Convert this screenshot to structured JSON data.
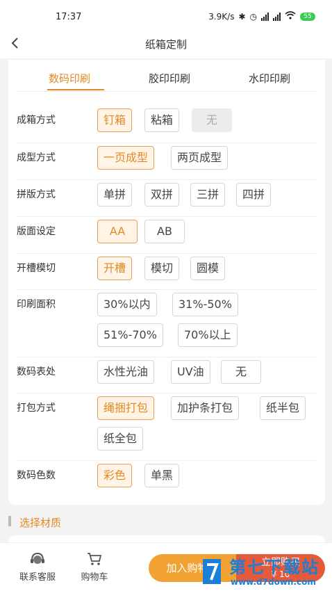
{
  "status_bar": {
    "time": "17:37",
    "net_speed": "3.9K/s",
    "battery": "55",
    "icons": [
      "bluetooth-icon",
      "alarm-icon",
      "hd-signal-icon",
      "hd-signal-icon",
      "wifi-icon",
      "battery-icon"
    ]
  },
  "nav": {
    "title": "纸箱定制",
    "back_icon": "chevron-left-icon"
  },
  "tabs": [
    {
      "label": "数码印刷",
      "active": true
    },
    {
      "label": "胶印印刷",
      "active": false
    },
    {
      "label": "水印印刷",
      "active": false
    }
  ],
  "options": [
    {
      "label": "成箱方式",
      "choices": [
        {
          "text": "钉箱",
          "state": "selected"
        },
        {
          "text": "粘箱",
          "state": "normal"
        },
        {
          "text": "无",
          "state": "disabled"
        }
      ]
    },
    {
      "label": "成型方式",
      "choices": [
        {
          "text": "一页成型",
          "state": "selected"
        },
        {
          "text": "两页成型",
          "state": "normal"
        }
      ]
    },
    {
      "label": "拼版方式",
      "choices": [
        {
          "text": "单拼",
          "state": "normal"
        },
        {
          "text": "双拼",
          "state": "normal"
        },
        {
          "text": "三拼",
          "state": "normal"
        },
        {
          "text": "四拼",
          "state": "normal"
        }
      ]
    },
    {
      "label": "版面设定",
      "choices": [
        {
          "text": "AA",
          "state": "selected"
        },
        {
          "text": "AB",
          "state": "normal"
        }
      ]
    },
    {
      "label": "开槽模切",
      "choices": [
        {
          "text": "开槽",
          "state": "selected"
        },
        {
          "text": "模切",
          "state": "normal"
        },
        {
          "text": "圆模",
          "state": "normal"
        }
      ]
    },
    {
      "label": "印刷面积",
      "choices": [
        {
          "text": "30%以内",
          "state": "normal"
        },
        {
          "text": "31%-50%",
          "state": "normal"
        },
        {
          "text": "51%-70%",
          "state": "normal"
        },
        {
          "text": "70%以上",
          "state": "normal"
        }
      ]
    },
    {
      "label": "数码表处",
      "choices": [
        {
          "text": "水性光油",
          "state": "normal"
        },
        {
          "text": "UV油",
          "state": "normal"
        },
        {
          "text": "无",
          "state": "normal"
        }
      ]
    },
    {
      "label": "打包方式",
      "choices": [
        {
          "text": "绳捆打包",
          "state": "selected"
        },
        {
          "text": "加护条打包",
          "state": "normal"
        },
        {
          "text": "纸半包",
          "state": "normal"
        },
        {
          "text": "纸全包",
          "state": "normal"
        }
      ]
    },
    {
      "label": "数码色数",
      "choices": [
        {
          "text": "彩色",
          "state": "selected"
        },
        {
          "text": "单黑",
          "state": "normal"
        }
      ]
    }
  ],
  "section": {
    "title": "选择材质"
  },
  "bottom": {
    "service_label": "联系客服",
    "cart_label": "购物车",
    "add_cart_label": "加入购物车",
    "buy_label": "立即购买",
    "price": "¥ 10"
  },
  "watermark": {
    "text": "第七下载站",
    "url": "www.d7down.com"
  },
  "colors": {
    "accent": "#e38a27",
    "cart_button": "#f2a233",
    "buy_button": "#e55a3b"
  }
}
